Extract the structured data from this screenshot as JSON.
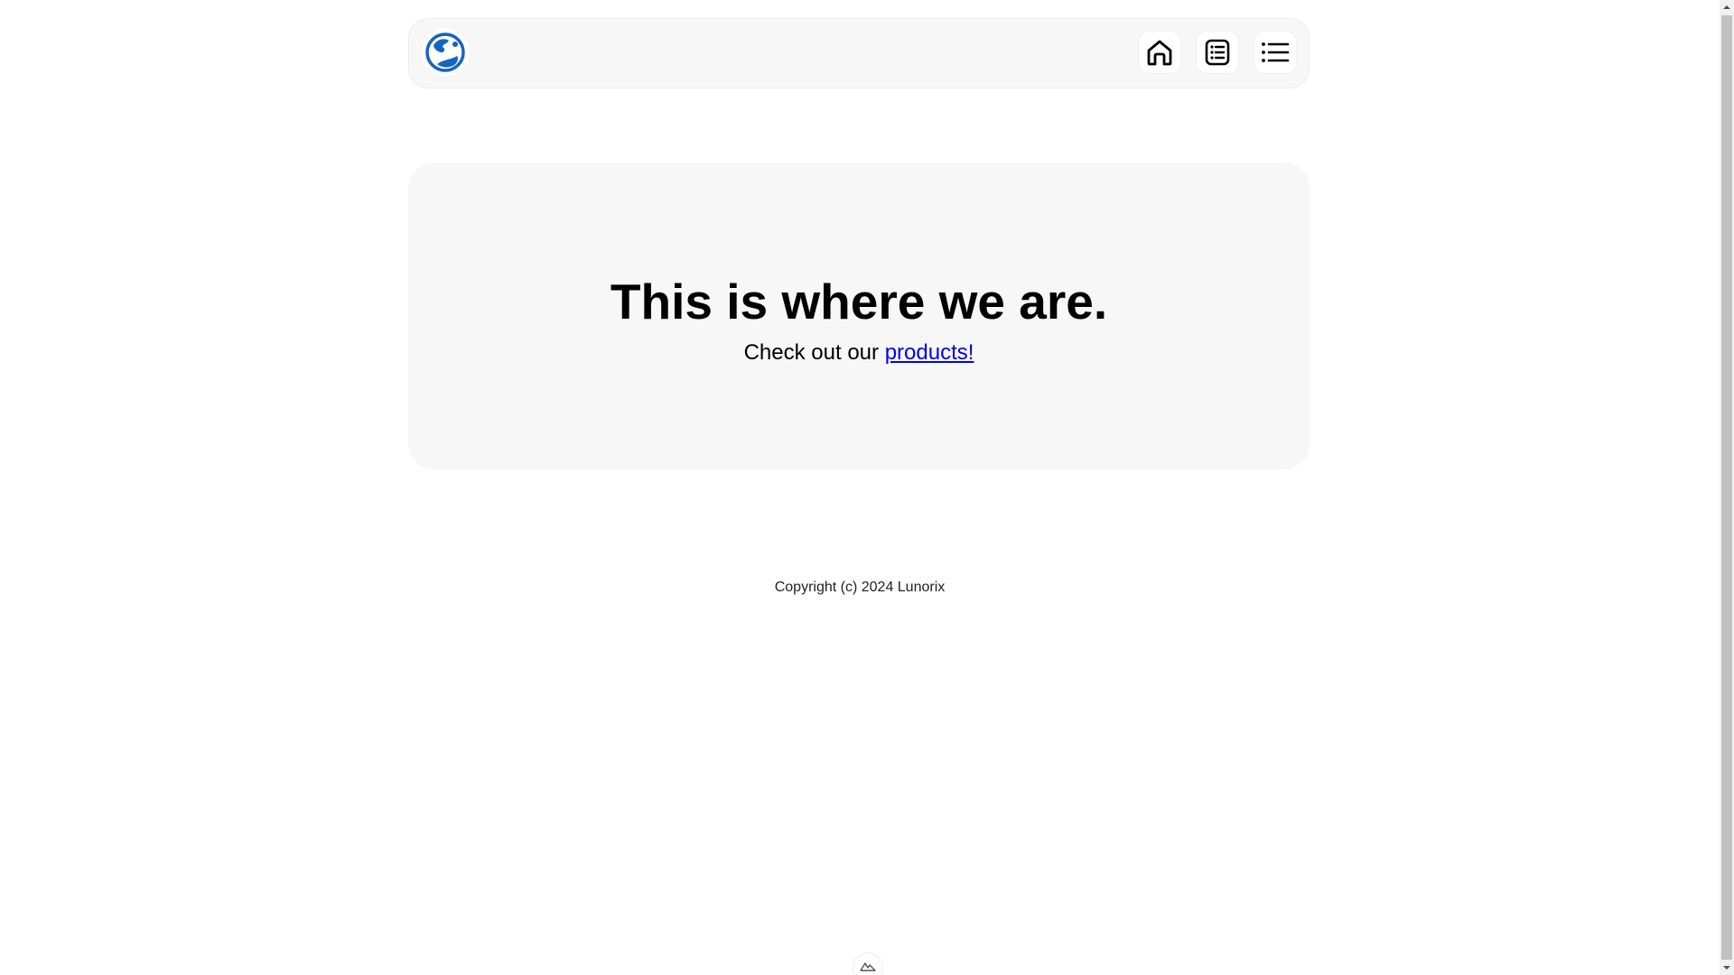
{
  "header": {
    "logo_icon": "globe-logo-icon",
    "nav": [
      {
        "icon": "home-icon",
        "label": "Home"
      },
      {
        "icon": "document-list-icon",
        "label": "Documents"
      },
      {
        "icon": "menu-list-icon",
        "label": "Menu"
      }
    ]
  },
  "hero": {
    "title": "This is where we are.",
    "sub_prefix": "Check out our ",
    "link_label": "products!"
  },
  "footer": {
    "copyright": "Copyright (c) 2024 Lunorix"
  },
  "bottom_badge": {
    "icon": "mountain-icon"
  },
  "colors": {
    "accent": "#1565c0",
    "link": "#0000ee",
    "card_bg": "#f7f7f7"
  }
}
